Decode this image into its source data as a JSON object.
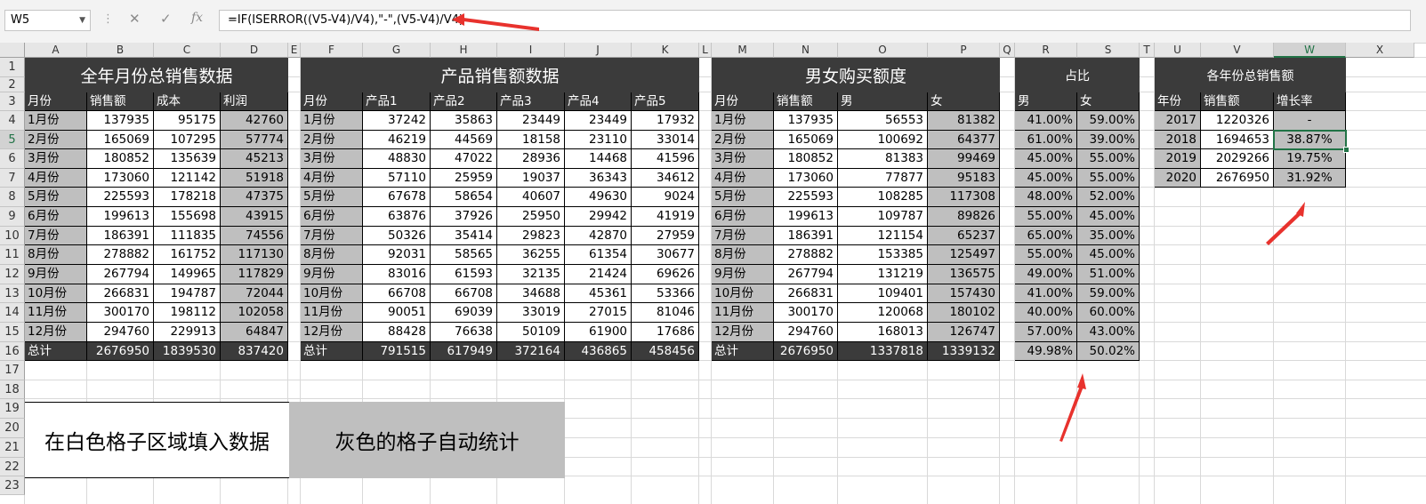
{
  "formula_bar": {
    "name_box": "W5",
    "cancel_glyph": "✕",
    "enter_glyph": "✓",
    "fx_glyph": "fx",
    "formula": "=IF(ISERROR((V5-V4)/V4),\"-\",(V5-V4)/V4)"
  },
  "columns": [
    "A",
    "B",
    "C",
    "D",
    "E",
    "F",
    "G",
    "H",
    "I",
    "J",
    "K",
    "L",
    "M",
    "N",
    "O",
    "P",
    "Q",
    "R",
    "S",
    "T",
    "U",
    "V",
    "W",
    "X"
  ],
  "rows": [
    "1",
    "2",
    "3",
    "4",
    "5",
    "6",
    "7",
    "8",
    "9",
    "10",
    "11",
    "12",
    "13",
    "14",
    "15",
    "16",
    "17",
    "18",
    "19",
    "20",
    "21",
    "22",
    "23"
  ],
  "selected_cell": {
    "column": "W",
    "row": "5"
  },
  "table1": {
    "title": "全年月份总销售数据",
    "headers": [
      "月份",
      "销售额",
      "成本",
      "利润"
    ],
    "rows": [
      [
        "1月份",
        "137935",
        "95175",
        "42760"
      ],
      [
        "2月份",
        "165069",
        "107295",
        "57774"
      ],
      [
        "3月份",
        "180852",
        "135639",
        "45213"
      ],
      [
        "4月份",
        "173060",
        "121142",
        "51918"
      ],
      [
        "5月份",
        "225593",
        "178218",
        "47375"
      ],
      [
        "6月份",
        "199613",
        "155698",
        "43915"
      ],
      [
        "7月份",
        "186391",
        "111835",
        "74556"
      ],
      [
        "8月份",
        "278882",
        "161752",
        "117130"
      ],
      [
        "9月份",
        "267794",
        "149965",
        "117829"
      ],
      [
        "10月份",
        "266831",
        "194787",
        "72044"
      ],
      [
        "11月份",
        "300170",
        "198112",
        "102058"
      ],
      [
        "12月份",
        "294760",
        "229913",
        "64847"
      ]
    ],
    "total": [
      "总计",
      "2676950",
      "1839530",
      "837420"
    ]
  },
  "table2": {
    "title": "产品销售额数据",
    "headers": [
      "月份",
      "产品1",
      "产品2",
      "产品3",
      "产品4",
      "产品5"
    ],
    "rows": [
      [
        "1月份",
        "37242",
        "35863",
        "23449",
        "23449",
        "17932"
      ],
      [
        "2月份",
        "46219",
        "44569",
        "18158",
        "23110",
        "33014"
      ],
      [
        "3月份",
        "48830",
        "47022",
        "28936",
        "14468",
        "41596"
      ],
      [
        "4月份",
        "57110",
        "25959",
        "19037",
        "36343",
        "34612"
      ],
      [
        "5月份",
        "67678",
        "58654",
        "40607",
        "49630",
        "9024"
      ],
      [
        "6月份",
        "63876",
        "37926",
        "25950",
        "29942",
        "41919"
      ],
      [
        "7月份",
        "50326",
        "35414",
        "29823",
        "42870",
        "27959"
      ],
      [
        "8月份",
        "92031",
        "58565",
        "36255",
        "61354",
        "30677"
      ],
      [
        "9月份",
        "83016",
        "61593",
        "32135",
        "21424",
        "69626"
      ],
      [
        "10月份",
        "66708",
        "66708",
        "34688",
        "45361",
        "53366"
      ],
      [
        "11月份",
        "90051",
        "69039",
        "33019",
        "27015",
        "81046"
      ],
      [
        "12月份",
        "88428",
        "76638",
        "50109",
        "61900",
        "17686"
      ]
    ],
    "total": [
      "总计",
      "791515",
      "617949",
      "372164",
      "436865",
      "458456"
    ]
  },
  "table3": {
    "title": "男女购买额度",
    "headers": [
      "月份",
      "销售额",
      "男",
      "女"
    ],
    "rows": [
      [
        "1月份",
        "137935",
        "56553",
        "81382"
      ],
      [
        "2月份",
        "165069",
        "100692",
        "64377"
      ],
      [
        "3月份",
        "180852",
        "81383",
        "99469"
      ],
      [
        "4月份",
        "173060",
        "77877",
        "95183"
      ],
      [
        "5月份",
        "225593",
        "108285",
        "117308"
      ],
      [
        "6月份",
        "199613",
        "109787",
        "89826"
      ],
      [
        "7月份",
        "186391",
        "121154",
        "65237"
      ],
      [
        "8月份",
        "278882",
        "153385",
        "125497"
      ],
      [
        "9月份",
        "267794",
        "131219",
        "136575"
      ],
      [
        "10月份",
        "266831",
        "109401",
        "157430"
      ],
      [
        "11月份",
        "300170",
        "120068",
        "180102"
      ],
      [
        "12月份",
        "294760",
        "168013",
        "126747"
      ]
    ],
    "total": [
      "总计",
      "2676950",
      "1337818",
      "1339132"
    ]
  },
  "table4": {
    "title": "占比",
    "headers": [
      "男",
      "女"
    ],
    "rows": [
      [
        "41.00%",
        "59.00%"
      ],
      [
        "61.00%",
        "39.00%"
      ],
      [
        "45.00%",
        "55.00%"
      ],
      [
        "45.00%",
        "55.00%"
      ],
      [
        "48.00%",
        "52.00%"
      ],
      [
        "55.00%",
        "45.00%"
      ],
      [
        "65.00%",
        "35.00%"
      ],
      [
        "55.00%",
        "45.00%"
      ],
      [
        "49.00%",
        "51.00%"
      ],
      [
        "41.00%",
        "59.00%"
      ],
      [
        "40.00%",
        "60.00%"
      ],
      [
        "57.00%",
        "43.00%"
      ]
    ],
    "total": [
      "49.98%",
      "50.02%"
    ]
  },
  "table5": {
    "title": "各年份总销售额",
    "headers": [
      "年份",
      "销售额",
      "增长率"
    ],
    "rows": [
      [
        "2017",
        "1220326",
        "-"
      ],
      [
        "2018",
        "1694653",
        "38.87%"
      ],
      [
        "2019",
        "2029266",
        "19.75%"
      ],
      [
        "2020",
        "2676950",
        "31.92%"
      ]
    ]
  },
  "legend": {
    "white_box": "在白色格子区域填入数据",
    "gray_box": "灰色的格子自动统计"
  },
  "colors": {
    "header_dark": "#3b3b3b",
    "auto_gray": "#bfbfbf",
    "annotation_red": "#e8322d",
    "selection_green": "#217346"
  }
}
